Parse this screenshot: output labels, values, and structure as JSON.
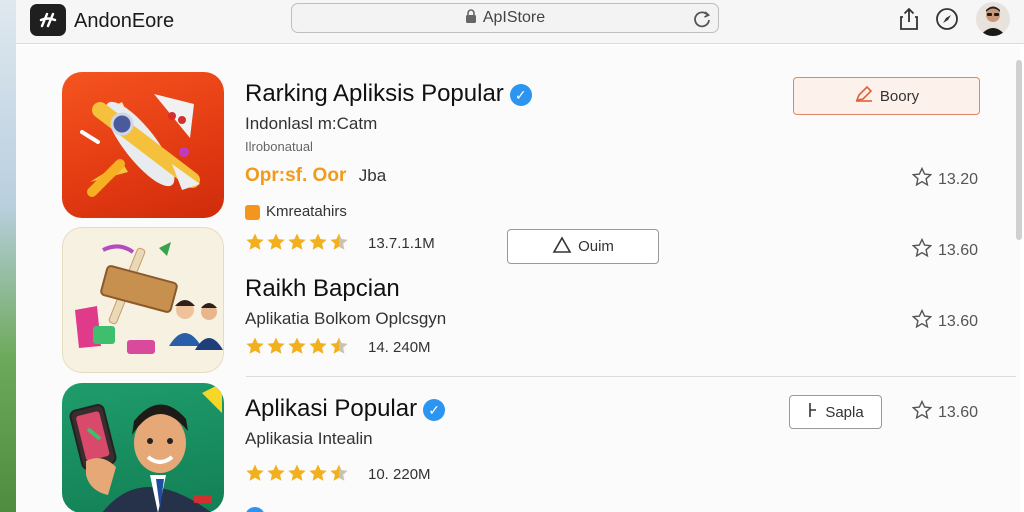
{
  "topbar": {
    "app_name": "AndonEore",
    "address_text": "ApIStore",
    "icons": [
      "app-logo-icon",
      "lock-icon",
      "reload-icon",
      "share-icon",
      "compass-icon",
      "avatar"
    ]
  },
  "apps": [
    {
      "title": "Rarking Apliksis Popular",
      "subtitle": "Indonlasl m:Catm",
      "subtitle2": "Ilrobonatual",
      "highlight_orange": "Opr:sf. Oor",
      "highlight_rest": "Jba",
      "tag_label": "Kmreatahirs",
      "rating_count": "13.7.1.1M",
      "rating_stars": 4.5,
      "primary_button": "Boory",
      "secondary_button": "Ouim",
      "right_rating_1": "13.20",
      "right_rating_2": "13.60"
    },
    {
      "title": "Raikh Bapcian",
      "subtitle": "Aplikatia Bolkom Oplcsgyn",
      "rating_count": "14. 240M",
      "rating_stars": 4.5,
      "right_rating": "13.60"
    },
    {
      "title": "Aplikasi Popular",
      "subtitle": "Aplikasia Intealin",
      "rating_count": "10. 220M",
      "rating_stars": 4.5,
      "button": "Sapla",
      "right_rating": "13.60"
    }
  ],
  "colors": {
    "accent_orange": "#f29a1a",
    "star_gold": "#f2b01e",
    "verified_blue": "#2b95ef",
    "primary_border": "#e2846a"
  }
}
